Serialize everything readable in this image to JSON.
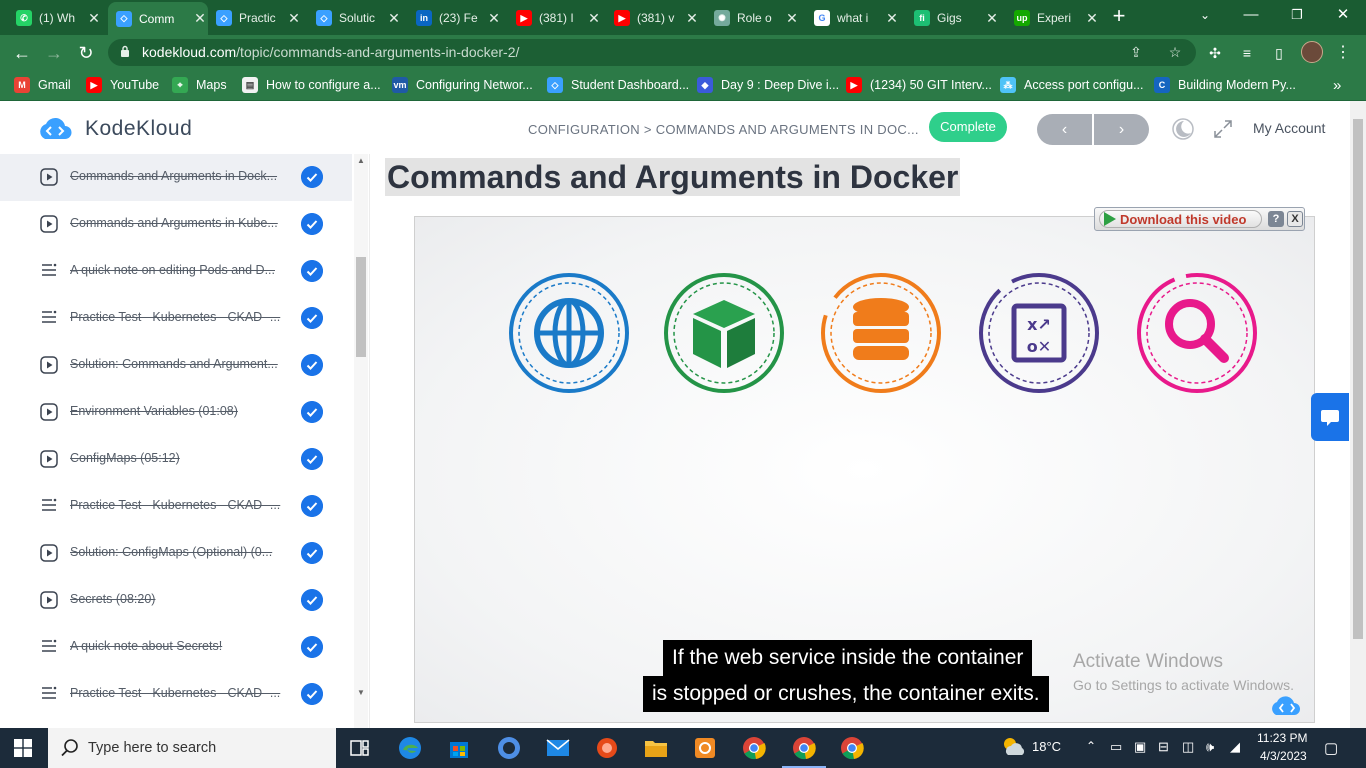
{
  "browser": {
    "tabs": [
      {
        "label": "(1) Wh",
        "favicon": "whatsapp-icon",
        "color": "#25d366"
      },
      {
        "label": "Comm",
        "favicon": "kodekloud-icon",
        "color": "#3aa0ff"
      },
      {
        "label": "Practic",
        "favicon": "kodekloud-icon",
        "color": "#3aa0ff"
      },
      {
        "label": "Solutic",
        "favicon": "kodekloud-icon",
        "color": "#3aa0ff"
      },
      {
        "label": "(23) Fe",
        "favicon": "linkedin-icon",
        "color": "#0a66c2"
      },
      {
        "label": "(381) I",
        "favicon": "youtube-icon",
        "color": "#ff0000"
      },
      {
        "label": "(381) v",
        "favicon": "youtube-icon",
        "color": "#ff0000"
      },
      {
        "label": "Role o",
        "favicon": "chatgpt-icon",
        "color": "#74aa9c"
      },
      {
        "label": "what i",
        "favicon": "google-icon",
        "color": "#ffffff"
      },
      {
        "label": "Gigs",
        "favicon": "fiverr-icon",
        "color": "#1dbf73"
      },
      {
        "label": "Experi",
        "favicon": "upwork-icon",
        "color": "#14a800"
      }
    ],
    "url_domain": "kodekloud.com",
    "url_path": "/topic/commands-and-arguments-in-docker-2/",
    "bookmarks": [
      {
        "label": "Gmail",
        "icon": "gmail-icon",
        "color": "#ea4335"
      },
      {
        "label": "YouTube",
        "icon": "youtube-icon",
        "color": "#ff0000"
      },
      {
        "label": "Maps",
        "icon": "maps-icon",
        "color": "#34a853"
      },
      {
        "label": "How to configure a...",
        "icon": "page-icon",
        "color": "#f2f2f2"
      },
      {
        "label": "Configuring Networ...",
        "icon": "vmware-icon",
        "color": "#1f5aa6"
      },
      {
        "label": "Student Dashboard...",
        "icon": "kodekloud-icon",
        "color": "#3aa0ff"
      },
      {
        "label": "Day 9 : Deep Dive i...",
        "icon": "diamond-icon",
        "color": "#3b5bdb"
      },
      {
        "label": "(1234) 50 GIT Interv...",
        "icon": "youtube-icon",
        "color": "#ff0000"
      },
      {
        "label": "Access port configu...",
        "icon": "cisco-icon",
        "color": "#4fc3f7"
      },
      {
        "label": "Building Modern Py...",
        "icon": "c-icon",
        "color": "#1565c0"
      }
    ]
  },
  "site": {
    "brand": "KodeKloud",
    "breadcrumb": "CONFIGURATION > COMMANDS AND ARGUMENTS IN DOC...",
    "complete_label": "Complete",
    "prev_label": "‹",
    "next_label": "›",
    "account_label": "My Account",
    "accent": "#2fcf8b"
  },
  "sidebar": {
    "lessons": [
      {
        "title": "Commands and Arguments in Dock...",
        "type": "video",
        "done": true,
        "active": true
      },
      {
        "title": "Commands and Arguments in Kube...",
        "type": "video",
        "done": true
      },
      {
        "title": "A quick note on editing Pods and D...",
        "type": "text",
        "done": true
      },
      {
        "title": "Practice Test - Kubernetes - CKAD -...",
        "type": "text",
        "done": true
      },
      {
        "title": "Solution: Commands and Argument...",
        "type": "video",
        "done": true
      },
      {
        "title": "Environment Variables (01:08)",
        "type": "video",
        "done": true
      },
      {
        "title": "ConfigMaps (05:12)",
        "type": "video",
        "done": true
      },
      {
        "title": "Practice Test - Kubernetes - CKAD -...",
        "type": "text",
        "done": true
      },
      {
        "title": "Solution: ConfigMaps (Optional) (0...",
        "type": "video",
        "done": true
      },
      {
        "title": "Secrets (08:20)",
        "type": "video",
        "done": true
      },
      {
        "title": "A quick note about Secrets!",
        "type": "text",
        "done": true
      },
      {
        "title": "Practice Test - Kubernetes - CKAD -...",
        "type": "text",
        "done": true
      }
    ]
  },
  "content": {
    "title": "Commands and Arguments in Docker",
    "download_label": "Download this video",
    "help_label": "?",
    "close_label": "X",
    "video_icons": [
      {
        "name": "globe-icon",
        "color": "#1a7ac8"
      },
      {
        "name": "package-icon",
        "color": "#249447"
      },
      {
        "name": "database-icon",
        "color": "#f07c1b"
      },
      {
        "name": "strategy-icon",
        "color": "#4b3a8c"
      },
      {
        "name": "search-icon",
        "color": "#e8198b"
      }
    ],
    "caption_line1": "If the web service inside the container",
    "caption_line2": "is stopped or crushes, the container exits.",
    "watermark_line1": "Activate Windows",
    "watermark_line2": "Go to Settings to activate Windows."
  },
  "taskbar": {
    "search_placeholder": "Type here to search",
    "weather": "18°C",
    "time": "11:23 PM",
    "date": "4/3/2023"
  }
}
